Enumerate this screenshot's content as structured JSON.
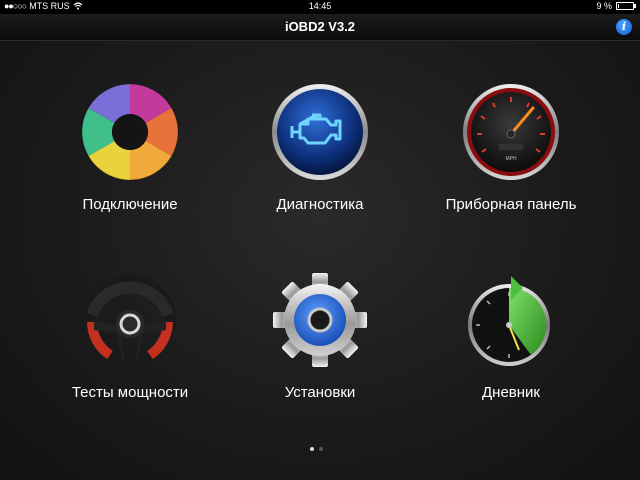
{
  "status_bar": {
    "signal_icon": "signal-dots-icon",
    "carrier": "MTS RUS",
    "time": "14:45",
    "battery_percent_text": "9 %",
    "battery_level": 0.09
  },
  "nav": {
    "title": "iOBD2 V3.2",
    "info_icon": "info-icon",
    "info_glyph": "i"
  },
  "tiles": [
    {
      "label": "Подключение",
      "icon": "puzzle-ring-icon"
    },
    {
      "label": "Диагностика",
      "icon": "check-engine-icon"
    },
    {
      "label": "Приборная панель",
      "icon": "speedometer-icon",
      "gauge_unit": "MPH"
    },
    {
      "label": "Тесты мощности",
      "icon": "steering-wheel-icon"
    },
    {
      "label": "Установки",
      "icon": "gear-icon"
    },
    {
      "label": "Дневник",
      "icon": "history-clock-icon"
    }
  ],
  "pager": {
    "pages": 2,
    "current": 1
  },
  "colors": {
    "accent_blue": "#0a5cd6",
    "gear_blue": "#1e5fd0",
    "history_green": "#3fae2a",
    "gauge_red": "#b01414"
  }
}
